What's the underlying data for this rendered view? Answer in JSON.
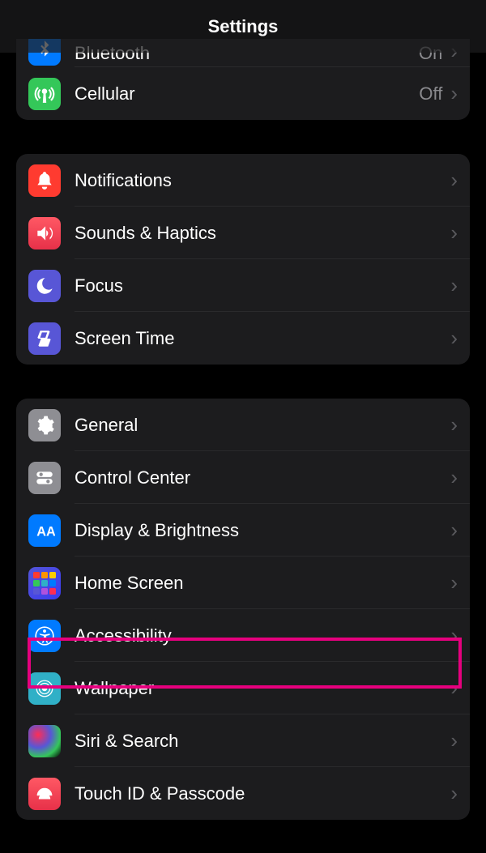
{
  "header": {
    "title": "Settings"
  },
  "groups": [
    {
      "id": "connectivity",
      "rows": [
        {
          "id": "bluetooth",
          "label": "Bluetooth",
          "value": "On",
          "partial": true
        },
        {
          "id": "cellular",
          "label": "Cellular",
          "value": "Off"
        }
      ]
    },
    {
      "id": "notifications-group",
      "rows": [
        {
          "id": "notifications",
          "label": "Notifications"
        },
        {
          "id": "sounds-haptics",
          "label": "Sounds & Haptics"
        },
        {
          "id": "focus",
          "label": "Focus"
        },
        {
          "id": "screen-time",
          "label": "Screen Time"
        }
      ]
    },
    {
      "id": "general-group",
      "rows": [
        {
          "id": "general",
          "label": "General"
        },
        {
          "id": "control-center",
          "label": "Control Center"
        },
        {
          "id": "display-brightness",
          "label": "Display & Brightness"
        },
        {
          "id": "home-screen",
          "label": "Home Screen"
        },
        {
          "id": "accessibility",
          "label": "Accessibility",
          "highlighted": true
        },
        {
          "id": "wallpaper",
          "label": "Wallpaper"
        },
        {
          "id": "siri-search",
          "label": "Siri & Search"
        },
        {
          "id": "touch-id-passcode",
          "label": "Touch ID & Passcode"
        }
      ]
    }
  ],
  "annotation": {
    "highlight_color": "#e6007e",
    "highlighted_item": "accessibility"
  }
}
